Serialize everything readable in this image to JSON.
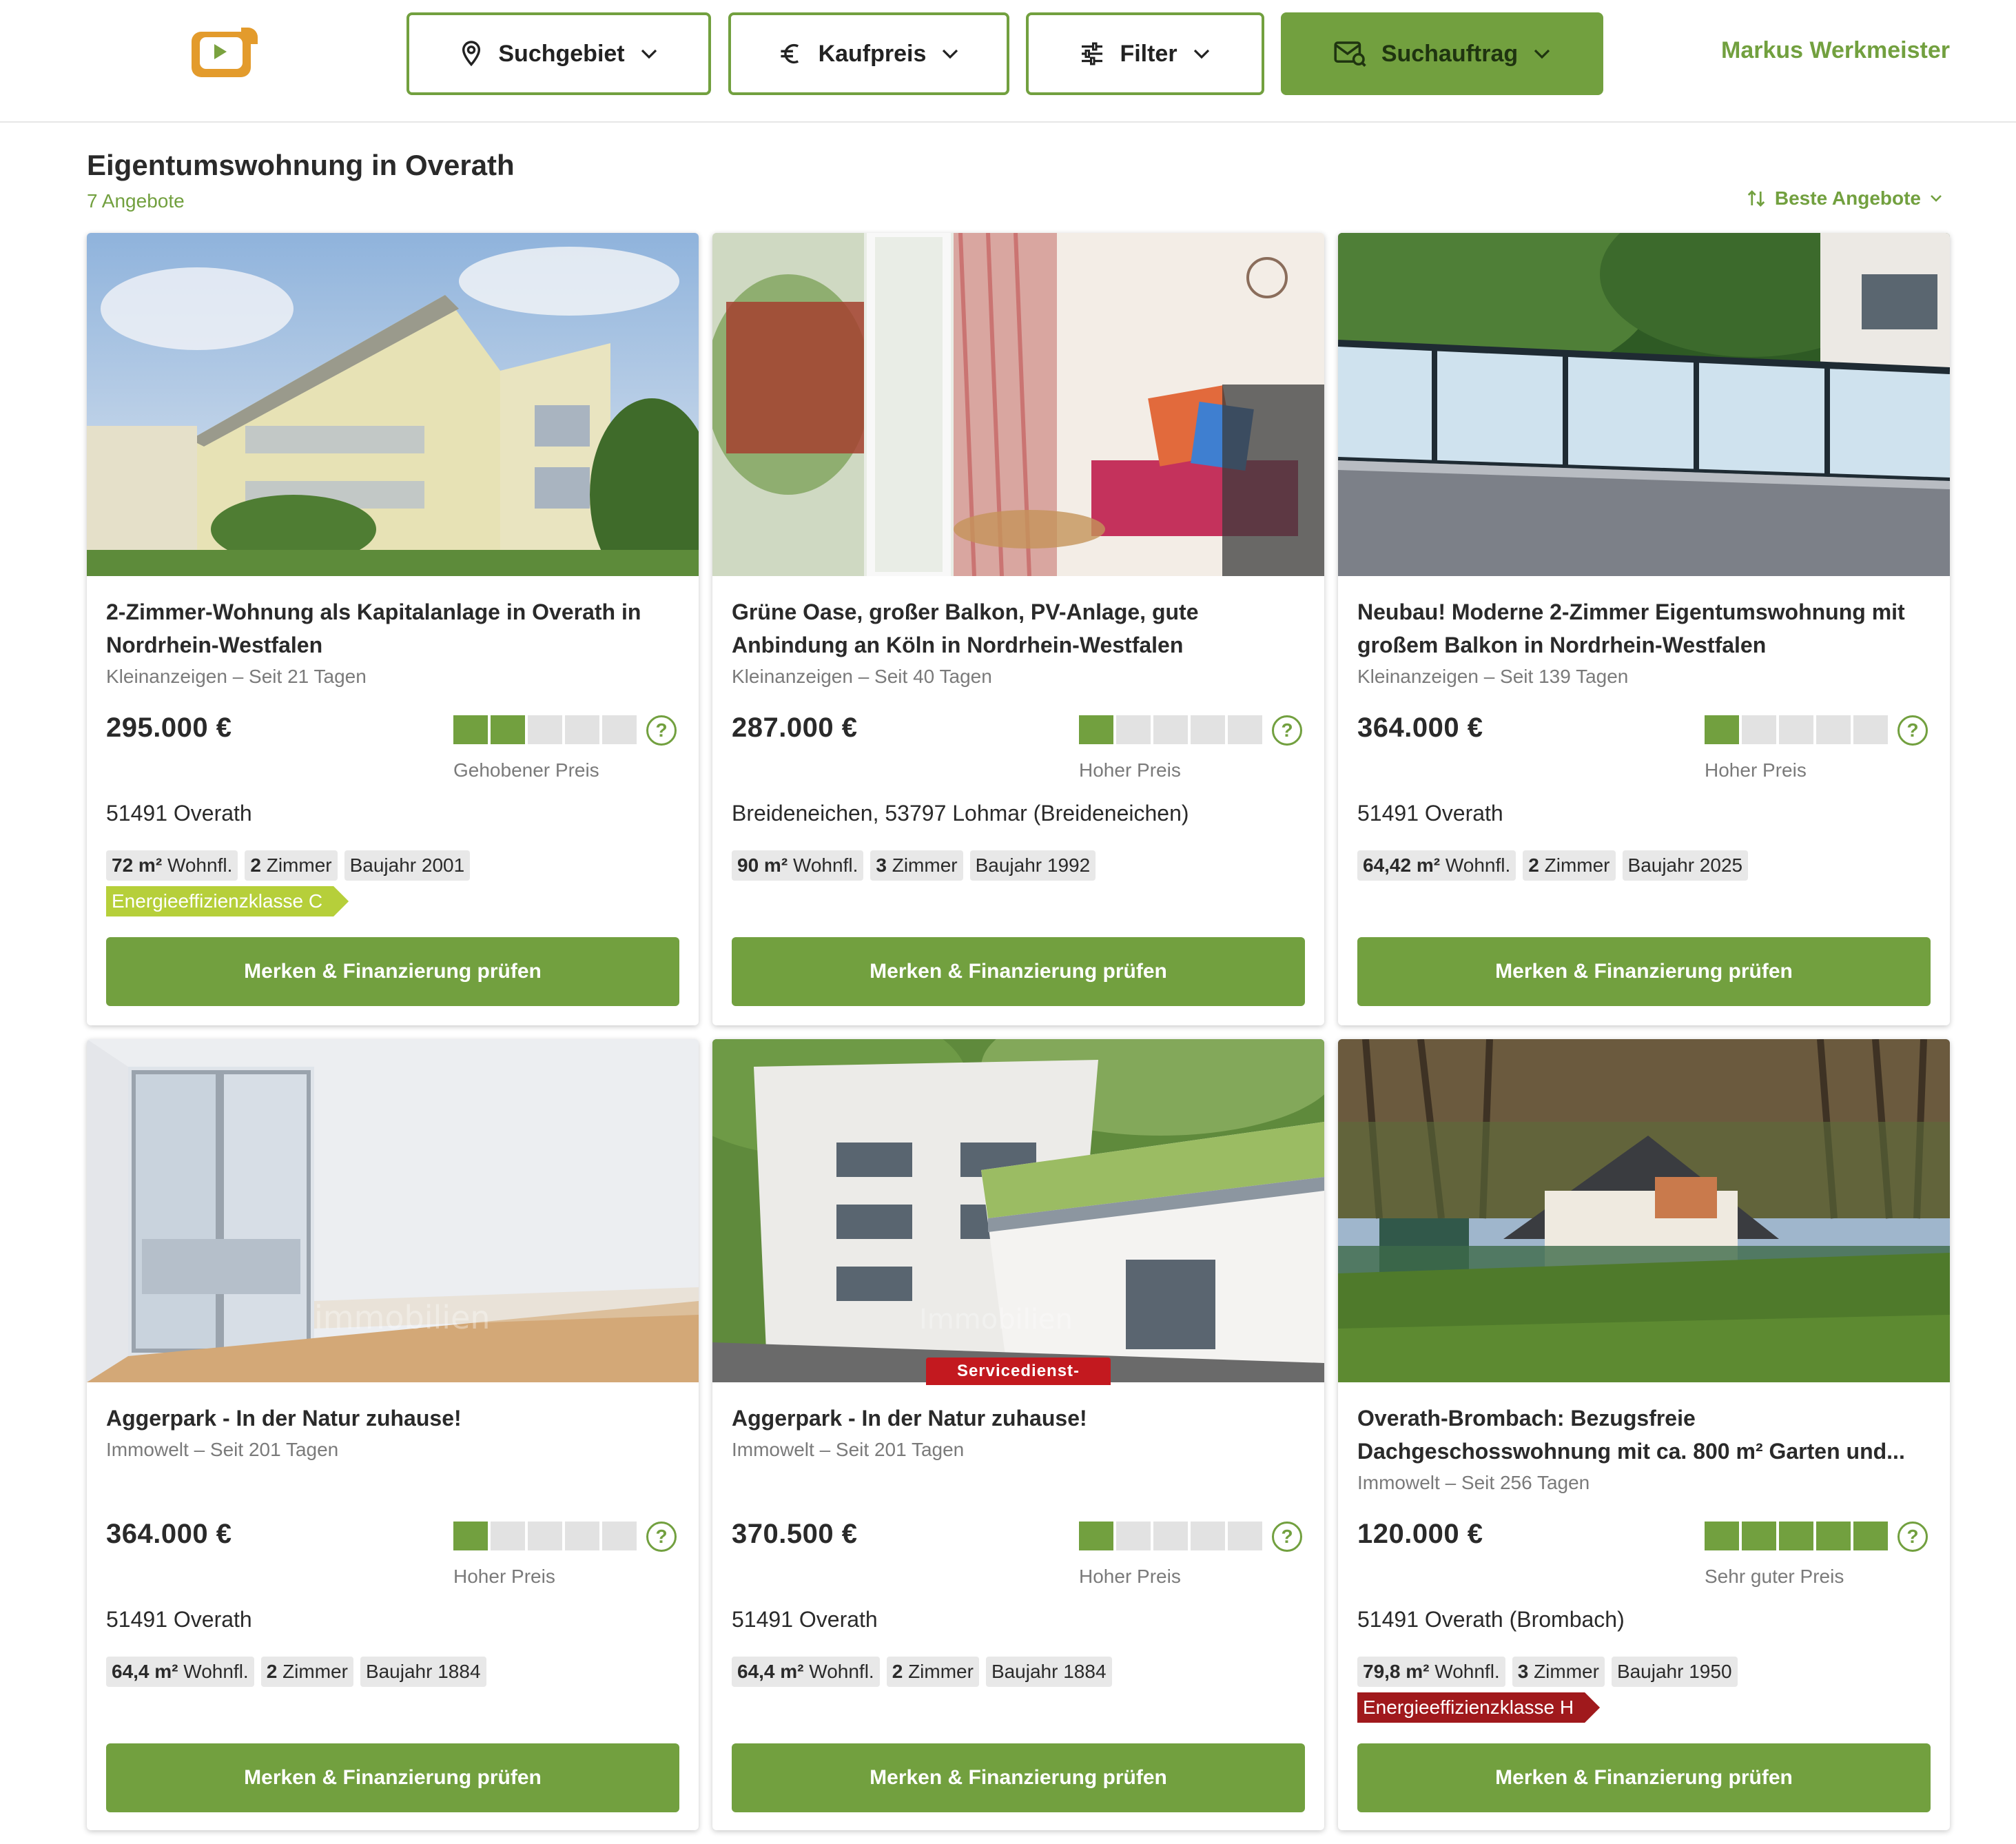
{
  "header": {
    "buttons": {
      "area": "Suchgebiet",
      "price": "Kaufpreis",
      "filter": "Filter",
      "search_order": "Suchauftrag"
    },
    "user_name": "Markus Werkmeister"
  },
  "results": {
    "title": "Eigentumswohnung in Overath",
    "count": "7 Angebote",
    "sort_label": "Beste Angebote"
  },
  "colors": {
    "accent": "#72a03f",
    "logo": "#e39b2c",
    "energy_c": "#b6cf3a",
    "energy_h": "#a0191c"
  },
  "listings": [
    {
      "title": "2-Zimmer-Wohnung als Kapitalanlage in Overath in Nordrhein-Westfalen",
      "source": "Kleinanzeigen – Seit 21 Tagen",
      "price": "295.000 €",
      "rating_level": 2,
      "rating_label": "Gehobener Preis",
      "address": "51491 Overath",
      "area_value": "72 m²",
      "area_unit": "Wohnfl.",
      "rooms_value": "2",
      "rooms_unit": "Zimmer",
      "year": "Baujahr 2001",
      "energy": "Energieeffizienzklasse C",
      "cta": "Merken & Finanzierung prüfen"
    },
    {
      "title": "Grüne Oase, großer Balkon, PV-Anlage, gute Anbindung an Köln in Nordrhein-Westfalen",
      "source": "Kleinanzeigen – Seit 40 Tagen",
      "price": "287.000 €",
      "rating_level": 1,
      "rating_label": "Hoher Preis",
      "address": "Breideneichen, 53797 Lohmar (Breideneichen)",
      "area_value": "90 m²",
      "area_unit": "Wohnfl.",
      "rooms_value": "3",
      "rooms_unit": "Zimmer",
      "year": "Baujahr 1992",
      "cta": "Merken & Finanzierung prüfen"
    },
    {
      "title": "Neubau! Moderne 2-Zimmer Eigentumswohnung mit großem Balkon in Nordrhein-Westfalen",
      "source": "Kleinanzeigen – Seit 139 Tagen",
      "price": "364.000 €",
      "rating_level": 1,
      "rating_label": "Hoher Preis",
      "address": "51491 Overath",
      "area_value": "64,42 m²",
      "area_unit": "Wohnfl.",
      "rooms_value": "2",
      "rooms_unit": "Zimmer",
      "year": "Baujahr 2025",
      "cta": "Merken & Finanzierung prüfen"
    },
    {
      "title": "Aggerpark - In der Natur zuhause!",
      "source": "Immowelt – Seit 201 Tagen",
      "price": "364.000 €",
      "rating_level": 1,
      "rating_label": "Hoher Preis",
      "address": "51491 Overath",
      "area_value": "64,4 m²",
      "area_unit": "Wohnfl.",
      "rooms_value": "2",
      "rooms_unit": "Zimmer",
      "year": "Baujahr 1884",
      "cta": "Merken & Finanzierung prüfen"
    },
    {
      "title": "Aggerpark - In der Natur zuhause!",
      "source": "Immowelt – Seit 201 Tagen",
      "price": "370.500 €",
      "rating_level": 1,
      "rating_label": "Hoher Preis",
      "address": "51491 Overath",
      "area_value": "64,4 m²",
      "area_unit": "Wohnfl.",
      "rooms_value": "2",
      "rooms_unit": "Zimmer",
      "year": "Baujahr 1884",
      "badge": "Servicedienst-",
      "cta": "Merken & Finanzierung prüfen"
    },
    {
      "title": "Overath-Brombach: Bezugsfreie Dachgeschosswohnung mit ca. 800 m² Garten und...",
      "source": "Immowelt – Seit 256 Tagen",
      "price": "120.000 €",
      "rating_level": 5,
      "rating_label": "Sehr guter Preis",
      "address": "51491 Overath (Brombach)",
      "area_value": "79,8 m²",
      "area_unit": "Wohnfl.",
      "rooms_value": "3",
      "rooms_unit": "Zimmer",
      "year": "Baujahr 1950",
      "energy": "Energieeffizienzklasse H",
      "cta": "Merken & Finanzierung prüfen"
    }
  ]
}
